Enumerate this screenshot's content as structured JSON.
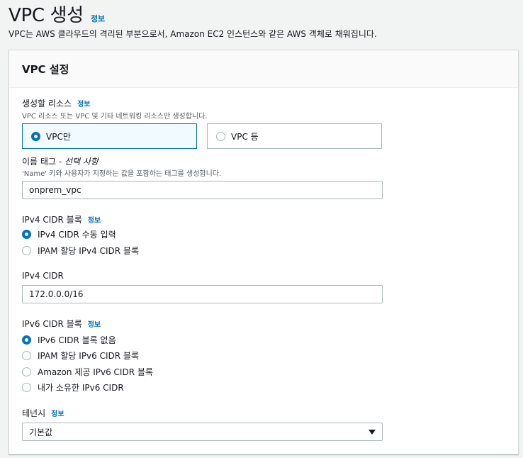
{
  "header": {
    "title": "VPC 생성",
    "info": "정보",
    "description": "VPC는 AWS 클라우드의 격리된 부분으로서, Amazon EC2 인스턴스와 같은 AWS 객체로 채워집니다."
  },
  "panel": {
    "title": "VPC 설정"
  },
  "resources": {
    "label": "생성할 리소스",
    "info": "정보",
    "description": "VPC 리소스 또는 VPC 및 기타 네트워킹 리소스만 생성합니다.",
    "options": [
      {
        "label": "VPC만",
        "selected": true
      },
      {
        "label": "VPC 등",
        "selected": false
      }
    ]
  },
  "name_tag": {
    "label": "이름 태그 - ",
    "optional": "선택 사항",
    "description": "'Name' 키와 사용자가 지정하는 값을 포함하는 태그를 생성합니다.",
    "value": "onprem_vpc"
  },
  "ipv4_block": {
    "label": "IPv4 CIDR 블록",
    "info": "정보",
    "options": [
      {
        "label": "IPv4 CIDR 수동 입력",
        "selected": true
      },
      {
        "label": "IPAM 할당 IPv4 CIDR 블록",
        "selected": false
      }
    ]
  },
  "ipv4_cidr": {
    "label": "IPv4 CIDR",
    "value": "172.0.0.0/16"
  },
  "ipv6_block": {
    "label": "IPv6 CIDR 블록",
    "info": "정보",
    "options": [
      {
        "label": "IPv6 CIDR 블록 없음",
        "selected": true
      },
      {
        "label": "IPAM 할당 IPv6 CIDR 블록",
        "selected": false
      },
      {
        "label": "Amazon 제공 IPv6 CIDR 블록",
        "selected": false
      },
      {
        "label": "내가 소유한 IPv6 CIDR",
        "selected": false
      }
    ]
  },
  "tenancy": {
    "label": "테넌시",
    "info": "정보",
    "value": "기본값"
  },
  "colors": {
    "accent": "#0073bb",
    "border": "#aab7b8",
    "selected_bg": "#f1faff"
  }
}
